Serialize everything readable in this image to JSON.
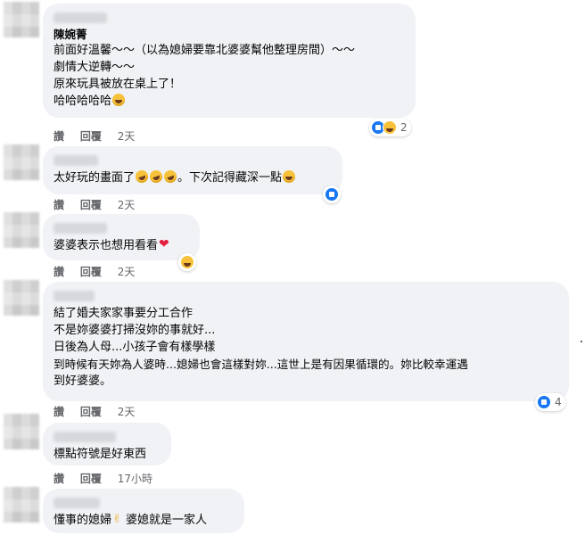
{
  "comments": [
    {
      "author": "陳婉菁",
      "lines": [
        "前面好溫馨～～（以為媳婦要靠北婆婆幫他整理房間）～～",
        "劇情大逆轉～～",
        "原來玩具被放在桌上了！",
        "哈哈哈哈哈"
      ],
      "actions": {
        "like": "讚",
        "reply": "回覆",
        "time": "2天"
      },
      "reactions": {
        "count": "2"
      }
    },
    {
      "lines": [
        "太好玩的畫面了",
        "。下次記得藏深一點"
      ],
      "actions": {
        "like": "讚",
        "reply": "回覆",
        "time": "2天"
      }
    },
    {
      "lines": [
        "婆婆表示也想用看看"
      ],
      "actions": {
        "like": "讚",
        "reply": "回覆",
        "time": "2天"
      }
    },
    {
      "lines": [
        "結了婚夫家家事要分工合作",
        "不是妳婆婆打掃沒妳的事就好...",
        "日後為人母...小孩子會有樣學樣",
        "到時候有天妳為人婆時...媳婦也會這樣對妳...這世上是有因果循環的。妳比較幸運遇",
        "到好婆婆。"
      ],
      "actions": {
        "like": "讚",
        "reply": "回覆",
        "time": "2天"
      },
      "reactions": {
        "count": "4"
      }
    },
    {
      "lines": [
        "標點符號是好東西"
      ],
      "actions": {
        "like": "讚",
        "reply": "回覆",
        "time": "17小時"
      }
    },
    {
      "lines": [
        "懂事的媳婦",
        "婆媳就是一家人"
      ]
    }
  ]
}
